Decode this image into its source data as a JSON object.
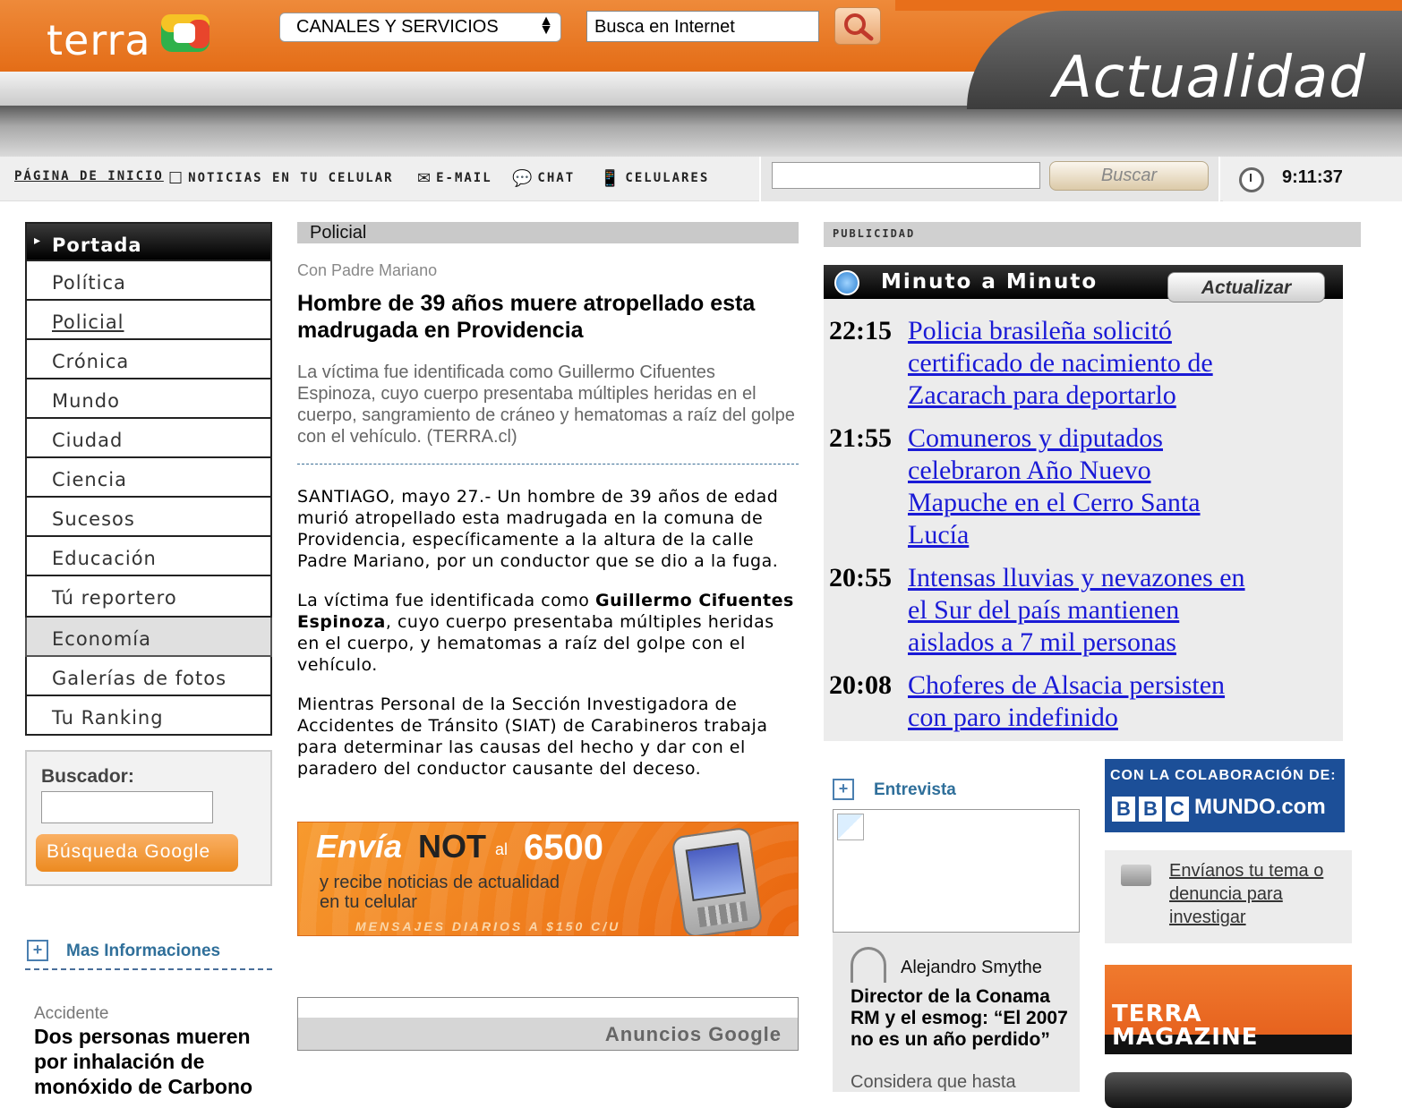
{
  "header": {
    "logo": "terra",
    "channels_select": "CANALES Y SERVICIOS",
    "web_search_value": "Busca en Internet",
    "section_title": "Actualidad"
  },
  "utility": {
    "home": "PÁGINA DE INICIO",
    "mobile_news": "NOTICIAS EN TU CELULAR",
    "email": "E-MAIL",
    "chat": "CHAT",
    "phones": "CELULARES",
    "search_button": "Buscar",
    "clock": "9:11:37"
  },
  "sidebar": {
    "items": [
      {
        "label": "Portada"
      },
      {
        "label": "Política"
      },
      {
        "label": "Policial"
      },
      {
        "label": "Crónica"
      },
      {
        "label": "Mundo"
      },
      {
        "label": "Ciudad"
      },
      {
        "label": "Ciencia"
      },
      {
        "label": "Sucesos"
      },
      {
        "label": "Educación"
      },
      {
        "label": "Tú reportero"
      },
      {
        "label": "Economía"
      },
      {
        "label": "Galerías de fotos"
      },
      {
        "label": "Tu Ranking"
      }
    ],
    "buscador_label": "Buscador:",
    "google_button": "Búsqueda Google",
    "more_info_label": "Mas Informaciones",
    "related_kicker": "Accidente",
    "related_title": "Dos personas mueren por inhalación de monóxido de Carbono"
  },
  "article": {
    "section": "Policial",
    "kicker": "Con Padre Mariano",
    "headline": "Hombre de 39 años muere atropellado esta madrugada en Providencia",
    "lead": "La víctima fue identificada como Guillermo Cifuentes Espinoza, cuyo cuerpo presentaba múltiples heridas en el cuerpo, sangramiento de cráneo y hematomas a raíz del golpe con el vehículo. (TERRA.cl)",
    "p1": "SANTIAGO, mayo 27.- Un hombre de 39 años de edad murió atropellado esta madrugada en la comuna de Providencia, específicamente a la altura de la calle Padre Mariano, por un conductor que se dio a la fuga.",
    "p2_before": "La víctima fue identificada como ",
    "p2_bold": "Guillermo Cifuentes Espinoza",
    "p2_after": ", cuyo cuerpo presentaba múltiples heridas en el cuerpo, y hematomas a raíz del golpe con el vehículo.",
    "p3": "Mientras Personal de la Sección Investigadora de Accidentes de Tránsito (SIAT) de Carabineros trabaja para determinar las causas del hecho y dar con el paradero del conductor causante del deceso."
  },
  "promo": {
    "envia": "Envía",
    "not": "NOT",
    "al": "al",
    "number": "6500",
    "line1": "y recibe noticias de actualidad",
    "line2": "en tu celular",
    "footer": "MENSAJES DIARIOS A $150 C/U"
  },
  "ads": {
    "label": "Anuncios Google"
  },
  "right": {
    "publicidad": "PUBLICIDAD",
    "minuto_title": "Minuto a Minuto",
    "refresh_button": "Actualizar",
    "news": [
      {
        "time": "22:15",
        "title": "Policia brasileña solicitó certificado de nacimiento de Zacarach para deportarlo"
      },
      {
        "time": "21:55",
        "title": "Comuneros y diputados celebraron Año Nuevo Mapuche en el Cerro Santa Lucía"
      },
      {
        "time": "20:55",
        "title": "Intensas lluvias y nevazones en el Sur del país mantienen aislados a 7 mil personas"
      },
      {
        "time": "20:08",
        "title": "Choferes de Alsacia persisten con paro indefinido"
      }
    ],
    "entrevista_label": "Entrevista",
    "interviewee": "Alejandro Smythe",
    "interview_title": "Director de la Conama RM y el esmog: “El 2007 no es un año perdido”",
    "interview_teaser": "Considera que hasta",
    "bbc_top": "CON LA COLABORACIÓN DE:",
    "bbc_letters": [
      "B",
      "B",
      "C"
    ],
    "bbc_mundo": "MUNDO.com",
    "envianos": "Envíanos tu tema o denuncia para investigar",
    "magazine": [
      "TERRA",
      "MAGAZINE"
    ]
  }
}
